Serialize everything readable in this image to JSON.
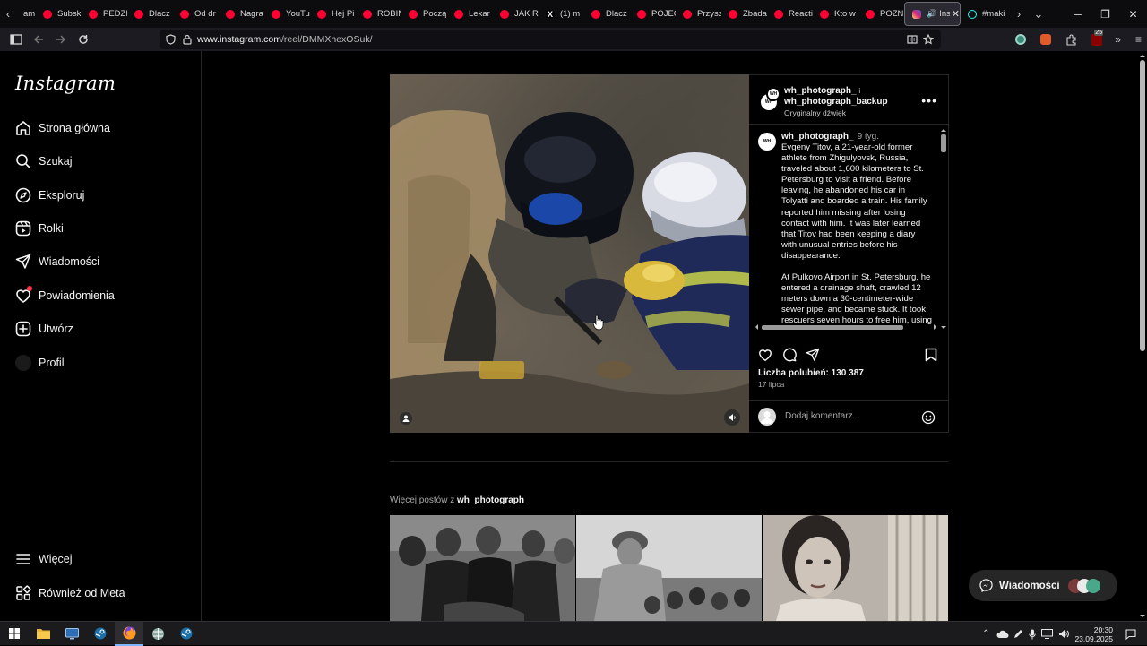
{
  "browser": {
    "tabs": [
      {
        "label": "am",
        "color": "#000000"
      },
      {
        "label": "Subsk",
        "color": "#ff0033"
      },
      {
        "label": "PEDZI",
        "color": "#ff0033"
      },
      {
        "label": "Dlacz",
        "color": "#ff0033"
      },
      {
        "label": "Od dr",
        "color": "#ff0033"
      },
      {
        "label": "Nagra",
        "color": "#ff0033"
      },
      {
        "label": "YouTu",
        "color": "#ff0033"
      },
      {
        "label": "Hej Pi",
        "color": "#ff0033"
      },
      {
        "label": "ROBIN",
        "color": "#ff0033"
      },
      {
        "label": "Począ",
        "color": "#ff0033"
      },
      {
        "label": "Lekar",
        "color": "#ff0033"
      },
      {
        "label": "JAK R",
        "color": "#ff0033"
      },
      {
        "label": "(1) m",
        "color": "#000000",
        "icon": "X"
      },
      {
        "label": "Dlacz",
        "color": "#ff0033"
      },
      {
        "label": "POJEC",
        "color": "#ff0033"
      },
      {
        "label": "Przysz",
        "color": "#ff0033"
      },
      {
        "label": "Zbada",
        "color": "#ff0033"
      },
      {
        "label": "Reacti",
        "color": "#ff0033"
      },
      {
        "label": "Kto w",
        "color": "#ff0033"
      },
      {
        "label": "POZN",
        "color": "#ff0033"
      }
    ],
    "active_tab": {
      "label": "Insta",
      "color": "#d62976"
    },
    "extra_tab": {
      "label": "#maki"
    },
    "url_host": "www.instagram.com",
    "url_path": "/reel/DMMXhexOSuk/",
    "extension_badge": "25"
  },
  "sidebar": {
    "logo": "Instagram",
    "items": [
      {
        "label": "Strona główna",
        "icon": "home-icon"
      },
      {
        "label": "Szukaj",
        "icon": "search-icon"
      },
      {
        "label": "Eksploruj",
        "icon": "compass-icon"
      },
      {
        "label": "Rolki",
        "icon": "reels-icon"
      },
      {
        "label": "Wiadomości",
        "icon": "send-icon"
      },
      {
        "label": "Powiadomienia",
        "icon": "heart-icon"
      },
      {
        "label": "Utwórz",
        "icon": "plus-square-icon"
      },
      {
        "label": "Profil",
        "icon": "avatar"
      }
    ],
    "bottom": [
      {
        "label": "Więcej",
        "icon": "menu-icon"
      },
      {
        "label": "Również od Meta",
        "icon": "meta-icon"
      }
    ]
  },
  "post": {
    "author1": "wh_photograph_",
    "connector": "i",
    "author2": "wh_photograph_backup",
    "audio": "Oryginalny dźwięk",
    "caption_user": "wh_photograph_",
    "caption_age": "9 tyg.",
    "caption_p1": "Evgeny Titov, a 21-year-old former athlete from Zhigulyovsk, Russia, traveled about 1,600 kilometers to St. Petersburg to visit a friend. Before leaving, he abandoned his car in Tolyatti and boarded a train. His family reported him missing after losing contact with him. It was later learned that Titov had been keeping a diary with unusual entries before his disappearance.",
    "caption_p2": "At Pulkovo Airport in St. Petersburg, he entered a drainage shaft, crawled 12 meters down a 30-centimeter-wide sewer pipe, and became stuck. It took rescuers seven hours to free him, using",
    "likes": "Liczba polubień: 130 387",
    "date": "17 lipca",
    "comment_placeholder": "Dodaj komentarz...",
    "avatar_text": "WH"
  },
  "more_posts": {
    "prefix": "Więcej postów z",
    "user": "wh_photograph_"
  },
  "messages_pill": {
    "label": "Wiadomości"
  },
  "taskbar": {
    "time": "20:30",
    "date": "23.09.2025"
  }
}
